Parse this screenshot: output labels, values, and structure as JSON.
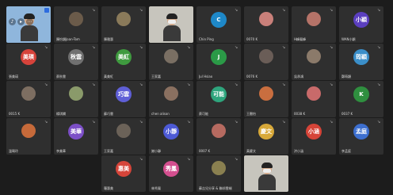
{
  "tiles": [
    {
      "name": "",
      "type": "self",
      "avatar": "",
      "color": "#4a90d9"
    },
    {
      "name": "陳怡穎Joan-Tom",
      "type": "photo",
      "avatar": "",
      "color": "#6b5b4a"
    },
    {
      "name": "陳雅惠",
      "type": "photo",
      "avatar": "",
      "color": "#8a7a5a"
    },
    {
      "name": "",
      "type": "video",
      "avatar": "",
      "color": "#c7c5bd"
    },
    {
      "name": "Chin Ping",
      "type": "letter",
      "avatar": "C",
      "color": "#1e88c8"
    },
    {
      "name": "0070 K",
      "type": "photo",
      "avatar": "",
      "color": "#c9807a"
    },
    {
      "name": "H峰鳳峰",
      "type": "photo",
      "avatar": "",
      "color": "#b57368"
    },
    {
      "name": "WAN小穎",
      "type": "letter",
      "avatar": "小穎",
      "color": "#5b3fbf"
    },
    {
      "name": "張美瑛",
      "type": "letter",
      "avatar": "美瑛",
      "color": "#d6433b"
    },
    {
      "name": "蔡秋雲",
      "type": "letter",
      "avatar": "秋雲",
      "color": "#707070"
    },
    {
      "name": "黃美紅",
      "type": "letter",
      "avatar": "美紅",
      "color": "#3f9a3f"
    },
    {
      "name": "王家嘉",
      "type": "photo",
      "avatar": "",
      "color": "#7a6f63"
    },
    {
      "name": "Jul Hsiao",
      "type": "letter",
      "avatar": "J",
      "color": "#2b9a47"
    },
    {
      "name": "0076 K",
      "type": "photo",
      "avatar": "",
      "color": "#6a5d57"
    },
    {
      "name": "吳承鴻",
      "type": "photo",
      "avatar": "",
      "color": "#8b7a6a"
    },
    {
      "name": "鄭筠穎",
      "type": "letter",
      "avatar": "筠穎",
      "color": "#3b8fc9"
    },
    {
      "name": "0015 K",
      "type": "photo",
      "avatar": "",
      "color": "#7d6e61"
    },
    {
      "name": "楊琪嫻",
      "type": "photo",
      "avatar": "",
      "color": "#8a9a6a"
    },
    {
      "name": "蘇巧雲",
      "type": "letter",
      "avatar": "巧雲",
      "color": "#5f5fd6"
    },
    {
      "name": "chen alison",
      "type": "photo",
      "avatar": "",
      "color": "#8a7060"
    },
    {
      "name": "蔡可能",
      "type": "letter",
      "avatar": "可能",
      "color": "#2ea57d"
    },
    {
      "name": "王罄怡",
      "type": "photo",
      "avatar": "",
      "color": "#c96e3f"
    },
    {
      "name": "0038 K",
      "type": "photo",
      "avatar": "",
      "color": "#c86a6a"
    },
    {
      "name": "0037 K",
      "type": "letter",
      "avatar": "K",
      "color": "#2f8f3f"
    },
    {
      "name": "溫珮玲",
      "type": "photo",
      "avatar": "",
      "color": "#c66a3a"
    },
    {
      "name": "李美華",
      "type": "letter",
      "avatar": "美華",
      "color": "#7c4fc7"
    },
    {
      "name": "王家嘉",
      "type": "photo",
      "avatar": "",
      "color": "#6b6258"
    },
    {
      "name": "謝小靜",
      "type": "letter",
      "avatar": "小靜",
      "color": "#4d5ad6"
    },
    {
      "name": "0007 K",
      "type": "photo",
      "avatar": "",
      "color": "#b66a60"
    },
    {
      "name": "黃慶文",
      "type": "letter",
      "avatar": "慶文",
      "color": "#d8a93a"
    },
    {
      "name": "洪小涵",
      "type": "letter",
      "avatar": "小涵",
      "color": "#d64438"
    },
    {
      "name": "李孟庭",
      "type": "letter",
      "avatar": "孟庭",
      "color": "#3d6fcf"
    },
    {
      "name": "羅惠美",
      "type": "letter",
      "avatar": "惠美",
      "color": "#d6453a"
    },
    {
      "name": "林秀鳳",
      "type": "letter",
      "avatar": "秀鳳",
      "color": "#d44f8f"
    },
    {
      "name": "蘇吉兒分享 & 聯邦雲端",
      "type": "photo",
      "avatar": "",
      "color": "#8a8050"
    },
    {
      "name": "",
      "type": "video",
      "avatar": "",
      "color": "#c7c5bd"
    }
  ]
}
